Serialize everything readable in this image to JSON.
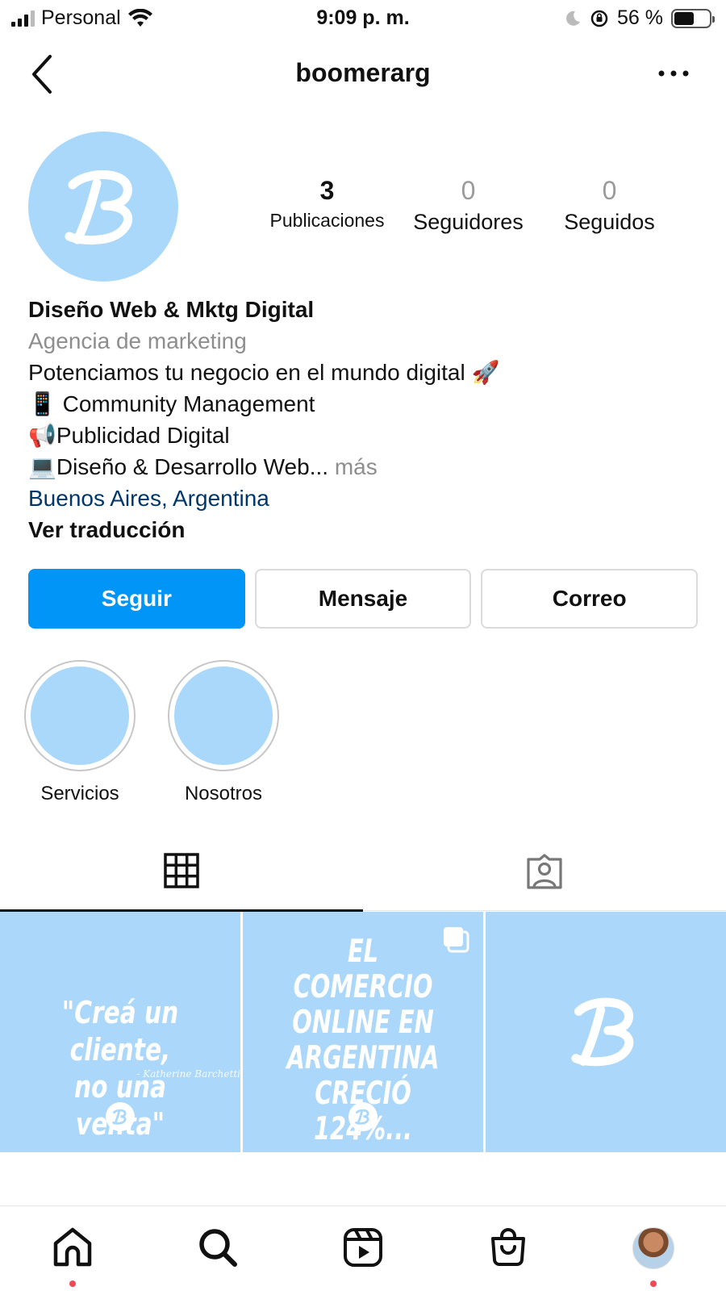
{
  "status_bar": {
    "carrier": "Personal",
    "time": "9:09 p. m.",
    "battery_percent": "56 %",
    "battery_level": 0.56
  },
  "header": {
    "username": "boomerarg",
    "back_icon": "chevron-left-icon",
    "more_icon": "more-horizontal-icon"
  },
  "profile": {
    "avatar_letter": "B",
    "stats": [
      {
        "value": "3",
        "label": "Publicaciones"
      },
      {
        "value": "0",
        "label": "Seguidores"
      },
      {
        "value": "0",
        "label": "Seguidos"
      }
    ],
    "name": "Diseño Web & Mktg Digital",
    "category": "Agencia de marketing",
    "bio_lines": [
      "Potenciamos tu negocio en el mundo digital 🚀",
      "📱 Community Management",
      "📢Publicidad Digital",
      "💻Diseño & Desarrollo Web..."
    ],
    "more_label": "más",
    "location": "Buenos Aires, Argentina",
    "translate_label": "Ver traducción"
  },
  "actions": {
    "follow": "Seguir",
    "message": "Mensaje",
    "email": "Correo"
  },
  "highlights": [
    {
      "label": "Servicios"
    },
    {
      "label": "Nosotros"
    }
  ],
  "tabs": [
    {
      "name": "posts-grid",
      "icon": "grid-icon",
      "active": true
    },
    {
      "name": "tagged",
      "icon": "tagged-user-icon",
      "active": false
    }
  ],
  "posts": [
    {
      "text_line1": "\"Creá un cliente,",
      "text_line2": "no una venta\"",
      "signature": "- Katherine Barchetti",
      "logo": "B"
    },
    {
      "text_line1": "EL COMERCIO",
      "text_line2": "ONLINE  EN",
      "text_line3": "ARGENTINA CRECIÓ",
      "text_line4": "124%...",
      "logo": "B",
      "multi": true
    },
    {
      "logo": "B"
    }
  ],
  "bottom_nav": [
    {
      "name": "home",
      "icon": "home-icon",
      "dot": true
    },
    {
      "name": "search",
      "icon": "search-icon",
      "dot": false
    },
    {
      "name": "reels",
      "icon": "reels-icon",
      "dot": false
    },
    {
      "name": "shop",
      "icon": "shop-bag-icon",
      "dot": false
    },
    {
      "name": "profile",
      "icon": "profile-avatar",
      "dot": true
    }
  ],
  "colors": {
    "accent_blue": "#0095f6",
    "brand_light_blue": "#a9d8fb",
    "link_blue": "#00376b",
    "muted_gray": "#8e8e8e",
    "notification_red": "#ed4956"
  }
}
